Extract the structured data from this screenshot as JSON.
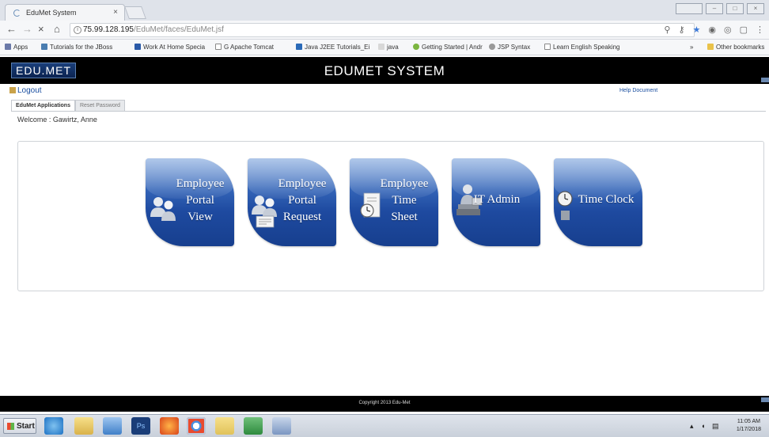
{
  "browser": {
    "tab_title": "EduMet System",
    "tab_close": "×",
    "url_host": "75.99.128.195",
    "url_path": "/EduMet/faces/EduMet.jsf",
    "bookmarks": [
      "Apps",
      "Tutorials for the JBoss",
      "Work At Home Specia",
      "G  Apache Tomcat",
      "Java J2EE Tutorials_Ei",
      "java",
      "Getting Started | Andr",
      "JSP Syntax",
      "Learn English Speaking",
      "»",
      "Other bookmarks"
    ]
  },
  "app": {
    "logo": "EDU.MET",
    "title": "EDUMET SYSTEM",
    "logout_label": "Logout",
    "help_label": "Help Document",
    "tabs": [
      {
        "label": "EduMet Applications",
        "active": true
      },
      {
        "label": "Reset Password",
        "active": false
      }
    ],
    "welcome": "Welcome : Gawirtz, Anne",
    "tiles": [
      {
        "label_lines": [
          "Employee",
          "Portal",
          "View"
        ],
        "icon": "users-icon"
      },
      {
        "label_lines": [
          "Employee",
          "Portal",
          "Request"
        ],
        "icon": "users-form-icon"
      },
      {
        "label_lines": [
          "Employee",
          "Time",
          "Sheet"
        ],
        "icon": "clock-document-icon"
      },
      {
        "label_lines": [
          "IT Admin"
        ],
        "icon": "admin-computer-icon"
      },
      {
        "label_lines": [
          "Time Clock"
        ],
        "icon": "clock-icon"
      }
    ],
    "footer": "Copyright 2013 Edu-Met"
  },
  "taskbar": {
    "start_label": "Start",
    "time": "11:05 AM",
    "date": "1/17/2018"
  },
  "colors": {
    "tile_blue": "#1e4aa0",
    "header_black": "#000000",
    "link_blue": "#1b4fa0"
  }
}
